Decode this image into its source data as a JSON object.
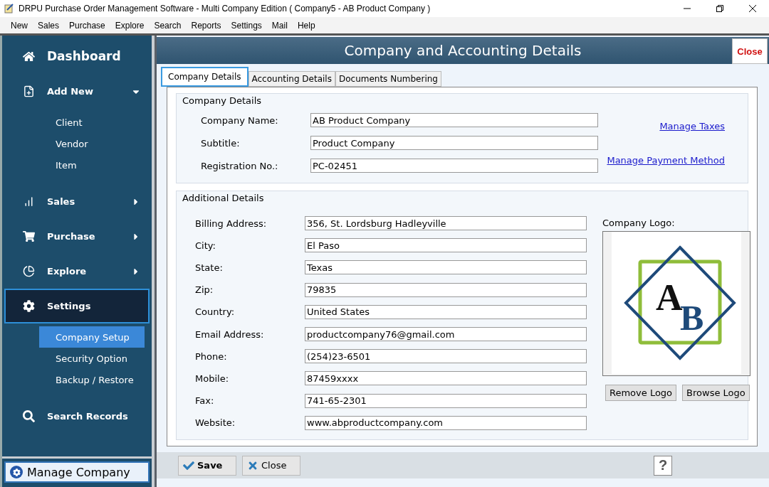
{
  "window": {
    "title": "DRPU Purchase Order Management Software - Multi Company Edition ( Company5 - AB Product Company )"
  },
  "menu": [
    "New",
    "Sales",
    "Purchase",
    "Explore",
    "Search",
    "Reports",
    "Settings",
    "Mail",
    "Help"
  ],
  "sidebar": {
    "items": [
      {
        "label": "Dashboard",
        "kind": "title",
        "selected": false
      },
      {
        "label": "Add New",
        "kind": "group",
        "expanded": true,
        "selected": false,
        "children": [
          {
            "label": "Client",
            "selected": false
          },
          {
            "label": "Vendor",
            "selected": false
          },
          {
            "label": "Item",
            "selected": false
          }
        ]
      },
      {
        "label": "Sales",
        "kind": "group",
        "expanded": false,
        "selected": false
      },
      {
        "label": "Purchase",
        "kind": "group",
        "expanded": false,
        "selected": false
      },
      {
        "label": "Explore",
        "kind": "group",
        "expanded": false,
        "selected": false
      },
      {
        "label": "Settings",
        "kind": "open",
        "selected": true,
        "children": [
          {
            "label": "Company Setup",
            "selected": true
          },
          {
            "label": "Security Option",
            "selected": false
          },
          {
            "label": "Backup / Restore",
            "selected": false
          }
        ]
      },
      {
        "label": "Search Records",
        "kind": "item",
        "selected": false
      }
    ],
    "footer": "Manage Company"
  },
  "header": {
    "title": "Company and Accounting Details",
    "close": "Close"
  },
  "tabs": [
    {
      "label": "Company Details",
      "selected": true
    },
    {
      "label": "Accounting Details",
      "selected": false
    },
    {
      "label": "Documents Numbering",
      "selected": false
    }
  ],
  "company_details": {
    "legend": "Company Details",
    "fields": [
      {
        "label": "Company Name:",
        "value": "AB Product Company"
      },
      {
        "label": "Subtitle:",
        "value": "Product Company"
      },
      {
        "label": "Registration No.:",
        "value": "PC-02451"
      }
    ],
    "links": [
      "Manage Taxes",
      "Manage Payment Method"
    ]
  },
  "additional_details": {
    "legend": "Additional Details",
    "fields": [
      {
        "label": "Billing Address:",
        "value": "356, St. Lordsburg Hadleyville"
      },
      {
        "label": "City:",
        "value": "El Paso"
      },
      {
        "label": "State:",
        "value": "Texas"
      },
      {
        "label": "Zip:",
        "value": "79835"
      },
      {
        "label": "Country:",
        "value": "United States"
      },
      {
        "label": "Email Address:",
        "value": "productcompany76@gmail.com"
      },
      {
        "label": "Phone:",
        "value": "(254)23-6501"
      },
      {
        "label": "Mobile:",
        "value": "87459xxxx"
      },
      {
        "label": "Fax:",
        "value": "741-65-2301"
      },
      {
        "label": "Website:",
        "value": "www.abproductcompany.com"
      }
    ],
    "logo": {
      "label": "Company Logo:",
      "letters": [
        "A",
        "B"
      ],
      "buttons": [
        "Remove Logo",
        "Browse Logo"
      ]
    }
  },
  "footer_buttons": [
    "Save",
    "Close"
  ],
  "help": "?"
}
